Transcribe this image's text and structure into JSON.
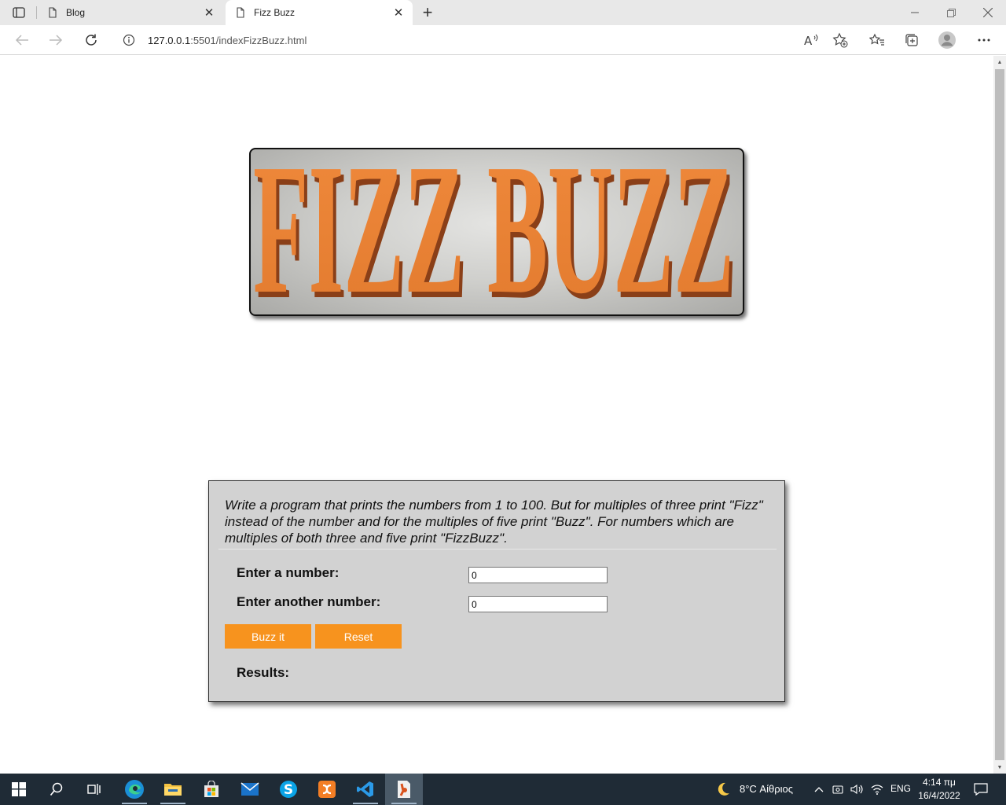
{
  "browser": {
    "tabs": [
      {
        "title": "Blog",
        "active": false
      },
      {
        "title": "Fizz Buzz",
        "active": true
      }
    ],
    "address": {
      "host": "127.0.0.1",
      "rest": ":5501/indexFizzBuzz.html"
    }
  },
  "page": {
    "logo_text": "FIZZ BUZZ",
    "description": "Write a program that prints the numbers from 1 to 100. But for multiples of three print \"Fizz\" instead of the number and for the multiples of five print \"Buzz\". For numbers which are multiples of both three and five print \"FizzBuzz\".",
    "first_label": "Enter a number:",
    "first_value": "0",
    "second_label": "Enter another number:",
    "second_value": "0",
    "buzz_button": "Buzz it",
    "reset_button": "Reset",
    "results_label": "Results:"
  },
  "taskbar": {
    "weather": "8°C  Αίθριος",
    "language": "ENG",
    "time": "4:14 πμ",
    "date": "16/4/2022"
  },
  "colors": {
    "accent_button": "#f7931e",
    "panel_bg": "#d2d2d2",
    "logo_letters": "#e8843a"
  }
}
